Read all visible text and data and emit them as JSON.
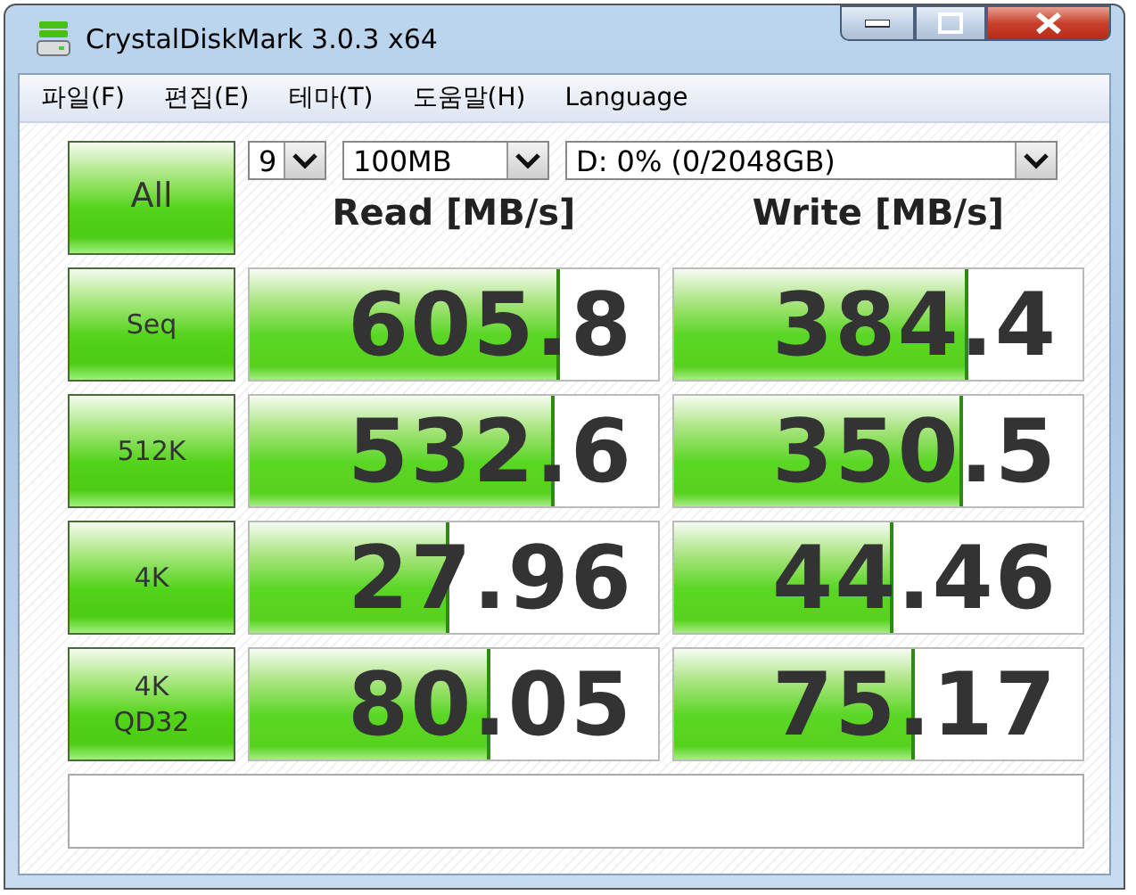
{
  "window": {
    "title": "CrystalDiskMark 3.0.3 x64"
  },
  "menu": [
    "파일(F)",
    "편집(E)",
    "테마(T)",
    "도움말(H)",
    "Language"
  ],
  "all_button": "All",
  "selects": [
    {
      "value": "9"
    },
    {
      "value": "100MB"
    },
    {
      "value": "D: 0% (0/2048GB)"
    }
  ],
  "headers": [
    "Read [MB/s]",
    "Write [MB/s]"
  ],
  "rows": [
    {
      "test": "Seq",
      "read": {
        "value": "605.8",
        "level": 0.75
      },
      "write": {
        "value": "384.4",
        "level": 0.71
      }
    },
    {
      "test": "512K",
      "read": {
        "value": "532.6",
        "level": 0.74
      },
      "write": {
        "value": "350.5",
        "level": 0.7
      }
    },
    {
      "test": "4K",
      "read": {
        "value": "27.96",
        "level": 0.48
      },
      "write": {
        "value": "44.46",
        "level": 0.53
      }
    },
    {
      "test": "4K\nQD32",
      "read": {
        "value": "80.05",
        "level": 0.58
      },
      "write": {
        "value": "75.17",
        "level": 0.58
      }
    }
  ]
}
